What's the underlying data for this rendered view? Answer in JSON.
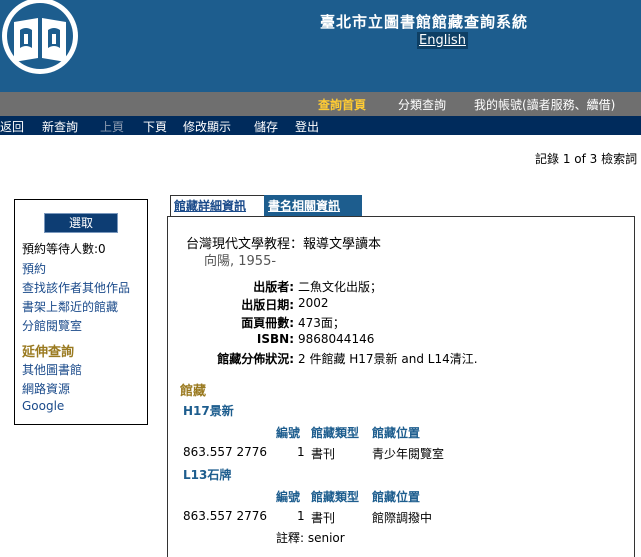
{
  "header": {
    "site_title": "臺北市立圖書館館藏查詢系統",
    "english_link": "English"
  },
  "main_nav": {
    "search_home": "查詢首頁",
    "category_search": "分類查詢",
    "my_account": "我的帳號(讀者服務、續借)"
  },
  "sub_nav": [
    {
      "label": "返回",
      "enabled": true
    },
    {
      "label": "新查詢",
      "enabled": true
    },
    {
      "label": "上頁",
      "enabled": false
    },
    {
      "label": "下頁",
      "enabled": true
    },
    {
      "label": "修改顯示",
      "enabled": true
    },
    {
      "label": "儲存",
      "enabled": true
    },
    {
      "label": "登出",
      "enabled": true
    }
  ],
  "record_counter": "記錄 1 of 3 檢索詞",
  "left_panel": {
    "select_button": "選取",
    "hold_queue": "預約等待人數:0",
    "reserve": "預約",
    "find_author_works": "查找該作者其他作品",
    "nearby_shelf": "書架上鄰近的館藏",
    "branch_reading_room": "分館閱覽室",
    "extended_search_heading": "延伸查詢",
    "other_libraries": "其他圖書館",
    "web_resources": "網路資源",
    "google": "Google"
  },
  "tabs": {
    "holding_detail": "館藏詳細資訊",
    "title_related": "書名相關資訊"
  },
  "record": {
    "title": "台灣現代文學教程：報導文學讀本",
    "author": "向陽, 1955-",
    "fields": [
      {
        "label": "出版者:",
        "value": "二魚文化出版；"
      },
      {
        "label": "出版日期:",
        "value": "2002"
      },
      {
        "label": "面頁冊數:",
        "value": "473面；"
      },
      {
        "label": "ISBN:",
        "value": "9868044146"
      },
      {
        "label": "館藏分佈狀況:",
        "value": "2 件館藏 H17景新 and L14清江."
      }
    ]
  },
  "holdings": {
    "heading": "館藏",
    "columns": [
      "編號",
      "館藏類型",
      "館藏位置"
    ],
    "branches": [
      {
        "name": "H17景新",
        "call_number": "863.557 2776",
        "copy": "1",
        "type": "書刊",
        "location": "青少年閱覽室",
        "note": ""
      },
      {
        "name": "L13石牌",
        "call_number": "863.557 2776",
        "copy": "1",
        "type": "書刊",
        "location": "館際調撥中",
        "note": "註釋: senior"
      }
    ]
  },
  "colors": {
    "header_blue": "#1d5d8e",
    "nav_gray": "#6f6f6f",
    "subnav_navy": "#002b5c",
    "accent_gold": "#ffcc33",
    "heading_brown": "#9a7a20"
  }
}
